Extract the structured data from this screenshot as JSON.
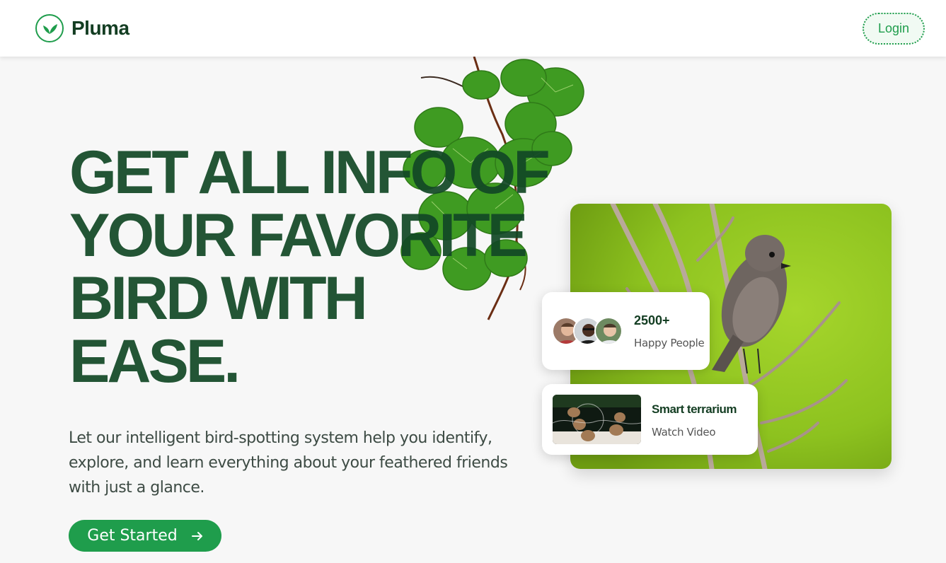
{
  "brand": {
    "name": "Pluma",
    "icon": "leaf-icon"
  },
  "nav": {
    "login_label": "Login"
  },
  "hero": {
    "headline_lines": [
      "GET ALL INFO OF",
      "YOUR FAVORITE",
      "BIRD WITH",
      "EASE."
    ],
    "subtext": "Let our intelligent bird-spotting system help you identify, explore, and learn everything about your feathered friends with just a glance.",
    "cta_label": "Get Started",
    "cta_icon": "arrow-right-icon"
  },
  "stats_card": {
    "count": "2500+",
    "label": "Happy People"
  },
  "video_card": {
    "title": "Smart terrarium",
    "subtitle": "Watch Video"
  },
  "colors": {
    "accent": "#1f9d4c",
    "headline": "#16502c",
    "background": "#f7f7f7"
  }
}
